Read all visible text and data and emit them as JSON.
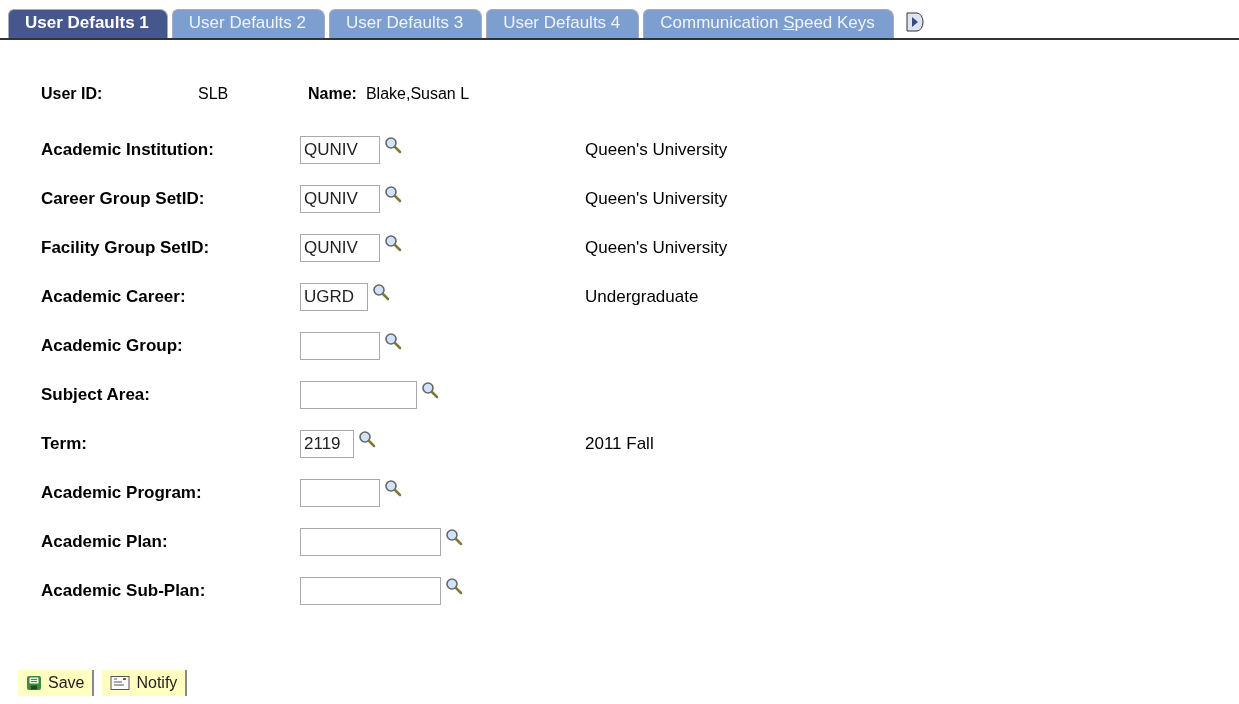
{
  "tabs": [
    {
      "label": "User Defaults 1",
      "selected": true
    },
    {
      "label": "User Defaults 2",
      "selected": false
    },
    {
      "label": "User Defaults 3",
      "selected": false
    },
    {
      "label": "User Defaults 4",
      "selected": false
    },
    {
      "label_before": "Communication ",
      "access_key": "S",
      "label_after": "peed Keys",
      "selected": false
    }
  ],
  "header": {
    "user_id_label": "User ID:",
    "user_id": "SLB",
    "name_label": "Name:",
    "name": "Blake,Susan L"
  },
  "fields": [
    {
      "label": "Academic Institution:",
      "value": "QUNIV",
      "description": "Queen's University"
    },
    {
      "label": "Career Group SetID:",
      "value": "QUNIV",
      "description": "Queen's University"
    },
    {
      "label": "Facility Group SetID:",
      "value": "QUNIV",
      "description": "Queen's University"
    },
    {
      "label": "Academic Career:",
      "value": "UGRD",
      "description": "Undergraduate"
    },
    {
      "label": "Academic Group:"
    },
    {
      "label": "Subject Area:"
    },
    {
      "label": "Term:",
      "value": "2119",
      "description": "2011 Fall"
    },
    {
      "label": "Academic Program:"
    },
    {
      "label": "Academic Plan:"
    },
    {
      "label": "Academic Sub-Plan:"
    }
  ],
  "buttons": [
    {
      "kind": "save",
      "label": "Save"
    },
    {
      "kind": "notify",
      "label": "Notify"
    }
  ]
}
